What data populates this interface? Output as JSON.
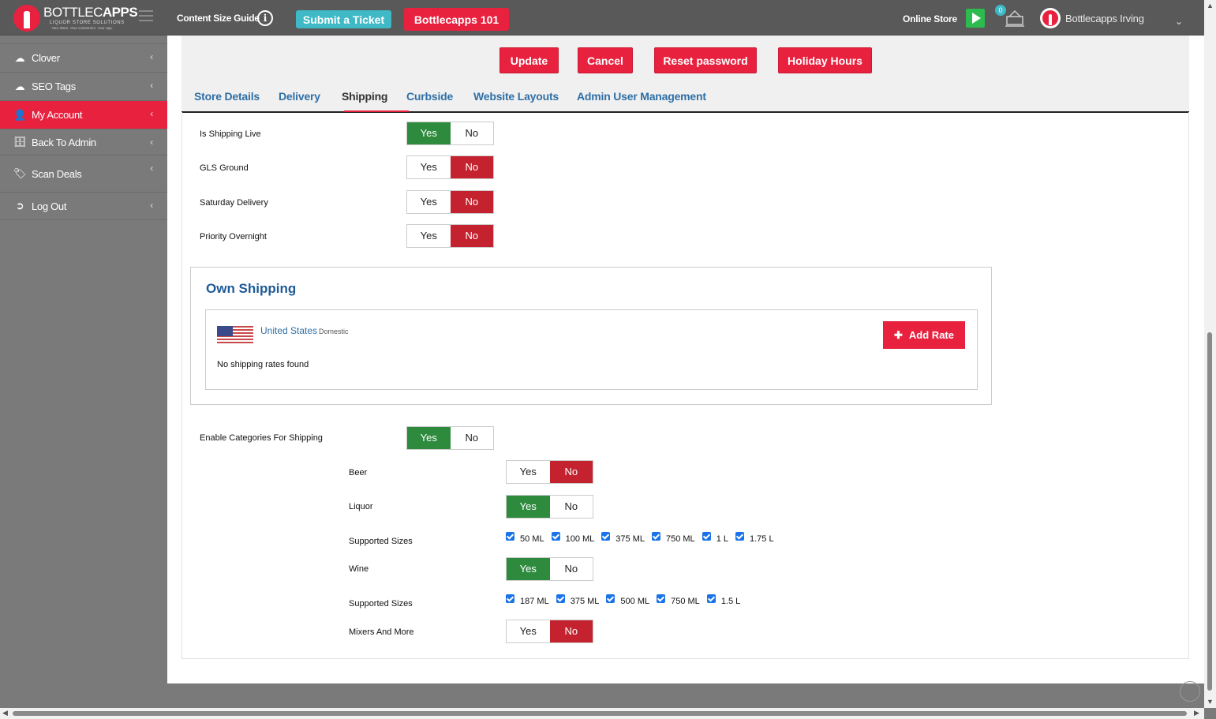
{
  "header": {
    "logo_title_a": "BOTTLEC",
    "logo_title_b": "APPS",
    "logo_sub": "LIQUOR STORE SOLUTIONS",
    "logo_tag": "Your Store. Your Customers. Your App.",
    "content_size_guide": "Content Size Guide",
    "submit_ticket": "Submit a Ticket",
    "bottlecapps_101": "Bottlecapps 101",
    "online_store": "Online Store",
    "notification_count": "0",
    "store_name": "Bottlecapps Irving"
  },
  "sidebar": {
    "items": [
      {
        "label": "Clover",
        "icon": "cloud-icon"
      },
      {
        "label": "SEO Tags",
        "icon": "cloud-icon"
      },
      {
        "label": "My Account",
        "icon": "user-icon"
      },
      {
        "label": "Back To Admin",
        "icon": "admin-icon"
      },
      {
        "label": "Scan Deals",
        "icon": "tag-icon"
      },
      {
        "label": "Log Out",
        "icon": "logout-icon"
      }
    ]
  },
  "actions": {
    "update": "Update",
    "cancel": "Cancel",
    "reset_password": "Reset password",
    "holiday_hours": "Holiday Hours"
  },
  "tabs": [
    "Store Details",
    "Delivery",
    "Shipping",
    "Curbside",
    "Website Layouts",
    "Admin User Management"
  ],
  "active_tab": "Shipping",
  "toggle_labels": {
    "yes": "Yes",
    "no": "No"
  },
  "shipping": {
    "is_shipping_live": {
      "label": "Is Shipping Live",
      "value": "Yes"
    },
    "gls_ground": {
      "label": "GLS Ground",
      "value": "No"
    },
    "saturday_delivery": {
      "label": "Saturday Delivery",
      "value": "No"
    },
    "priority_overnight": {
      "label": "Priority Overnight",
      "value": "No"
    }
  },
  "own_shipping": {
    "title": "Own Shipping",
    "country": "United States",
    "country_sub": "Domestic",
    "empty_text": "No shipping rates found",
    "add_rate": "Add Rate"
  },
  "categories": {
    "enable": {
      "label": "Enable Categories For Shipping",
      "value": "Yes"
    },
    "beer": {
      "label": "Beer",
      "value": "No"
    },
    "liquor": {
      "label": "Liquor",
      "value": "Yes"
    },
    "liquor_sizes_label": "Supported Sizes",
    "liquor_sizes": [
      "50 ML",
      "100 ML",
      "375 ML",
      "750 ML",
      "1 L",
      "1.75 L"
    ],
    "wine": {
      "label": "Wine",
      "value": "Yes"
    },
    "wine_sizes_label": "Supported Sizes",
    "wine_sizes": [
      "187 ML",
      "375 ML",
      "500 ML",
      "750 ML",
      "1.5 L"
    ],
    "mixers": {
      "label": "Mixers And More",
      "value": "No"
    }
  },
  "colors": {
    "brand_red": "#e8213f",
    "yes_green": "#2e8b3e",
    "no_red": "#c3222e",
    "link_blue": "#2f6fa6"
  }
}
